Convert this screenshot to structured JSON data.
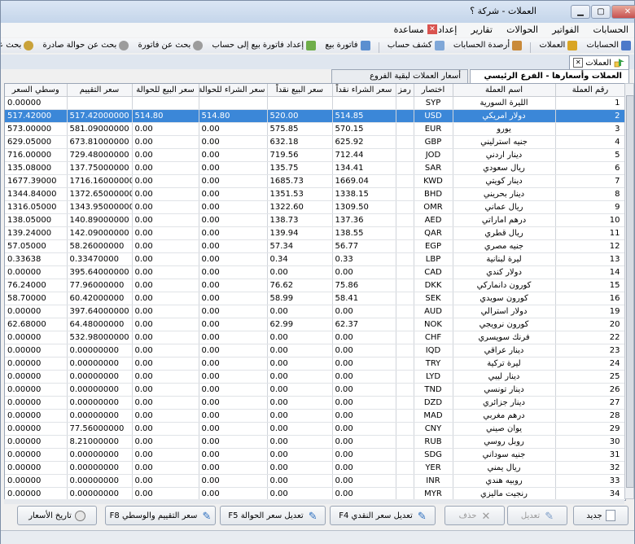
{
  "window": {
    "title": "العملات - شركة ؟"
  },
  "menu": [
    "الحسابات",
    "الفواتير",
    "الحوالات",
    "تقارير",
    "إعداد",
    "مساعدة"
  ],
  "toolbar": [
    "الحسابات",
    "العملات",
    "أرصدة الحسابات",
    "كشف حساب",
    "فاتورة بيع",
    "إعداد فاتورة بيع إلى حساب",
    "بحث عن فاتورة",
    "بحث عن حوالة صادرة",
    "بحث عن حوالة واردة"
  ],
  "doc_tab": {
    "label": "العملات"
  },
  "sub_tabs": {
    "active": "العملات وأسعارها - الفرع الرئيسي",
    "other": "أسعار العملات لبقية الفروع"
  },
  "columns": [
    "رقم العملة",
    "اسم العملة",
    "اختصار",
    "رمز",
    "سعر الشراء نقداً",
    "سعر البيع نقداً",
    "سعر الشراء للحوالة",
    "سعر البيع للحوالة",
    "سعر التقييم",
    "وسطي السعر"
  ],
  "rows": [
    [
      "1",
      "الليرة السورية",
      "SYP",
      "",
      "",
      "",
      "",
      "",
      "",
      "0.00000"
    ],
    [
      "2",
      "دولار امريكي",
      "USD",
      "",
      "514.85",
      "520.00",
      "514.80",
      "514.80",
      "517.42000000",
      "517.42000"
    ],
    [
      "3",
      "يورو",
      "EUR",
      "",
      "570.15",
      "575.85",
      "0.00",
      "0.00",
      "581.09000000",
      "573.00000"
    ],
    [
      "4",
      "جنيه استرليني",
      "GBP",
      "",
      "625.92",
      "632.18",
      "0.00",
      "0.00",
      "673.81000000",
      "629.05000"
    ],
    [
      "5",
      "دينار اردني",
      "JOD",
      "",
      "712.44",
      "719.56",
      "0.00",
      "0.00",
      "729.48000000",
      "716.00000"
    ],
    [
      "6",
      "ريال سعودي",
      "SAR",
      "",
      "134.41",
      "135.75",
      "0.00",
      "0.00",
      "137.75000000",
      "135.08000"
    ],
    [
      "7",
      "دينار كويتي",
      "KWD",
      "",
      "1669.04",
      "1685.73",
      "0.00",
      "0.00",
      "1716.16000000",
      "1677.39000"
    ],
    [
      "8",
      "دينار بحريني",
      "BHD",
      "",
      "1338.15",
      "1351.53",
      "0.00",
      "0.00",
      "1372.65000000",
      "1344.84000"
    ],
    [
      "9",
      "ريال عماني",
      "OMR",
      "",
      "1309.50",
      "1322.60",
      "0.00",
      "0.00",
      "1343.95000000",
      "1316.05000"
    ],
    [
      "10",
      "درهم اماراتي",
      "AED",
      "",
      "137.36",
      "138.73",
      "0.00",
      "0.00",
      "140.89000000",
      "138.05000"
    ],
    [
      "11",
      "ريال قطري",
      "QAR",
      "",
      "138.55",
      "139.94",
      "0.00",
      "0.00",
      "142.09000000",
      "139.24000"
    ],
    [
      "12",
      "جنيه مصري",
      "EGP",
      "",
      "56.77",
      "57.34",
      "0.00",
      "0.00",
      "58.26000000",
      "57.05000"
    ],
    [
      "13",
      "ليرة لبنانية",
      "LBP",
      "",
      "0.33",
      "0.34",
      "0.00",
      "0.00",
      "0.33470000",
      "0.33638"
    ],
    [
      "14",
      "دولار كندي",
      "CAD",
      "",
      "0.00",
      "0.00",
      "0.00",
      "0.00",
      "395.64000000",
      "0.00000"
    ],
    [
      "15",
      "كورون دانماركي",
      "DKK",
      "",
      "75.86",
      "76.62",
      "0.00",
      "0.00",
      "77.96000000",
      "76.24000"
    ],
    [
      "16",
      "كورون سويدي",
      "SEK",
      "",
      "58.41",
      "58.99",
      "0.00",
      "0.00",
      "60.42000000",
      "58.70000"
    ],
    [
      "19",
      "دولار استرالي",
      "AUD",
      "",
      "0.00",
      "0.00",
      "0.00",
      "0.00",
      "397.64000000",
      "0.00000"
    ],
    [
      "20",
      "كورون نرويجي",
      "NOK",
      "",
      "62.37",
      "62.99",
      "0.00",
      "0.00",
      "64.48000000",
      "62.68000"
    ],
    [
      "22",
      "فرنك سويسري",
      "CHF",
      "",
      "0.00",
      "0.00",
      "0.00",
      "0.00",
      "532.98000000",
      "0.00000"
    ],
    [
      "23",
      "دينار عراقي",
      "IQD",
      "",
      "0.00",
      "0.00",
      "0.00",
      "0.00",
      "0.00000000",
      "0.00000"
    ],
    [
      "24",
      "ليرة تركية",
      "TRY",
      "",
      "0.00",
      "0.00",
      "0.00",
      "0.00",
      "0.00000000",
      "0.00000"
    ],
    [
      "25",
      "دينار ليبي",
      "LYD",
      "",
      "0.00",
      "0.00",
      "0.00",
      "0.00",
      "0.00000000",
      "0.00000"
    ],
    [
      "26",
      "دينار تونسي",
      "TND",
      "",
      "0.00",
      "0.00",
      "0.00",
      "0.00",
      "0.00000000",
      "0.00000"
    ],
    [
      "27",
      "دينار جزائري",
      "DZD",
      "",
      "0.00",
      "0.00",
      "0.00",
      "0.00",
      "0.00000000",
      "0.00000"
    ],
    [
      "28",
      "درهم مغربي",
      "MAD",
      "",
      "0.00",
      "0.00",
      "0.00",
      "0.00",
      "0.00000000",
      "0.00000"
    ],
    [
      "29",
      "يوان صيني",
      "CNY",
      "",
      "0.00",
      "0.00",
      "0.00",
      "0.00",
      "77.56000000",
      "0.00000"
    ],
    [
      "30",
      "روبل روسي",
      "RUB",
      "",
      "0.00",
      "0.00",
      "0.00",
      "0.00",
      "8.21000000",
      "0.00000"
    ],
    [
      "31",
      "جنيه سوداني",
      "SDG",
      "",
      "0.00",
      "0.00",
      "0.00",
      "0.00",
      "0.00000000",
      "0.00000"
    ],
    [
      "32",
      "ريال يمني",
      "YER",
      "",
      "0.00",
      "0.00",
      "0.00",
      "0.00",
      "0.00000000",
      "0.00000"
    ],
    [
      "33",
      "روبيه هندي",
      "INR",
      "",
      "0.00",
      "0.00",
      "0.00",
      "0.00",
      "0.00000000",
      "0.00000"
    ],
    [
      "34",
      "رنجيت ماليزي",
      "MYR",
      "",
      "0.00",
      "0.00",
      "0.00",
      "0.00",
      "0.00000000",
      "0.00000"
    ]
  ],
  "selected_row": 1,
  "buttons": {
    "new": "جديد",
    "edit": "تعديل",
    "delete": "حذف",
    "cash_rate": "تعديل سعر النقدي F4",
    "transfer_rate": "تعديل سعر الحوالة F5",
    "valuation_rate": "سعر التقييم والوسطي F8",
    "price_history": "تاريخ الأسعار"
  },
  "colors": {
    "selection": "#3b87d8",
    "accent_green": "#3aa34a",
    "accent_blue": "#2c6fbf"
  }
}
